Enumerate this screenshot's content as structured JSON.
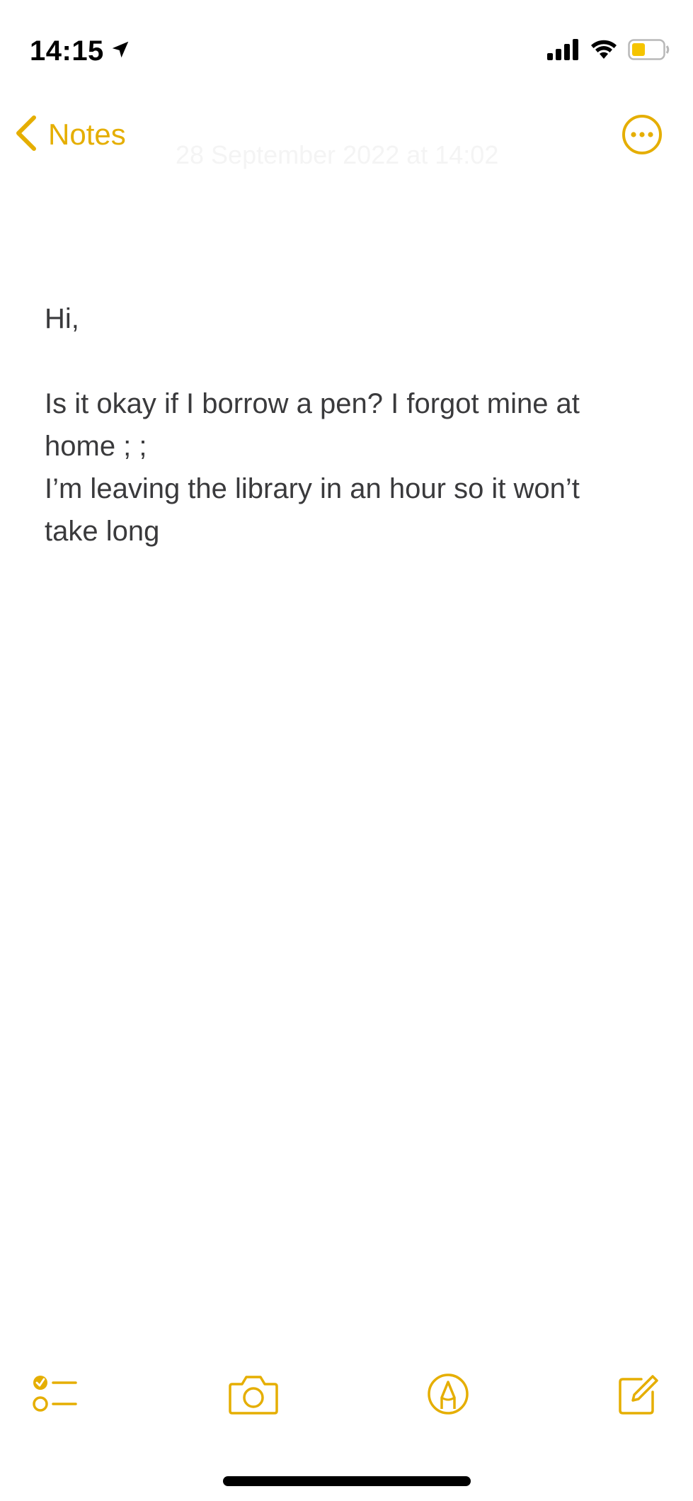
{
  "status_bar": {
    "time": "14:15",
    "icons": [
      "location-arrow-icon",
      "cellular-signal-icon",
      "wifi-icon",
      "battery-icon"
    ]
  },
  "nav": {
    "back_label": "Notes",
    "date_text": "28 September 2022 at 14:02",
    "more_icon": "ellipsis-circle-icon"
  },
  "note": {
    "lines": [
      "Hi,",
      "",
      "Is it okay if I borrow a pen? I forgot mine at",
      "home ;  ;",
      "I’m leaving the library in an hour so it won’t",
      "take long"
    ]
  },
  "toolbar": {
    "items": [
      "checklist-icon",
      "camera-icon",
      "markup-pen-icon",
      "compose-icon"
    ]
  },
  "colors": {
    "accent": "#E5AE00",
    "text": "#3a3a3c",
    "background": "#ffffff",
    "battery_fill": "#F5C400"
  }
}
